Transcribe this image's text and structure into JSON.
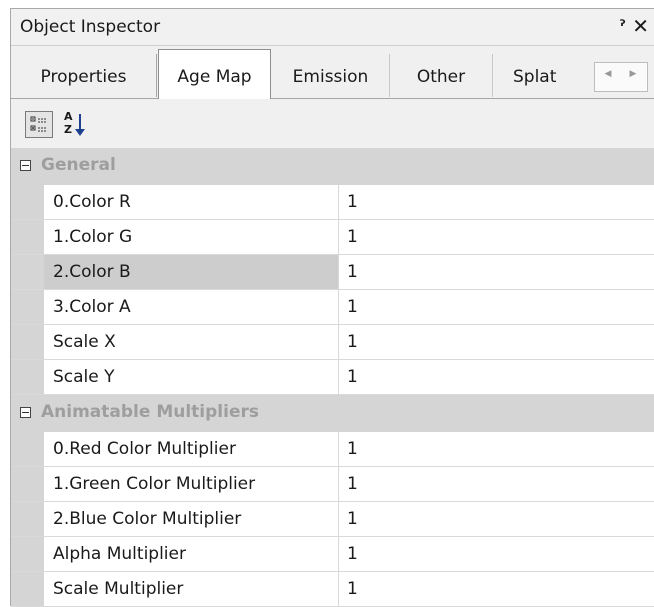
{
  "window": {
    "title": "Object Inspector",
    "pin_icon": "pin-icon",
    "close_icon": "close-icon"
  },
  "tabs": [
    {
      "label": "Properties",
      "active": false
    },
    {
      "label": "Age Map",
      "active": true
    },
    {
      "label": "Emission",
      "active": false
    },
    {
      "label": "Other",
      "active": false
    },
    {
      "label": "Splat",
      "active": false
    }
  ],
  "tab_scroll": {
    "left_icon": "chevron-left-icon",
    "right_icon": "chevron-right-icon"
  },
  "toolbar": {
    "categorized_icon": "categorized-view-icon",
    "sort_icon": "sort-alphabetical-icon",
    "sort_glyph_top": "A",
    "sort_glyph_bottom": "Z"
  },
  "categories": [
    {
      "label": "General",
      "properties": [
        {
          "name": "0.Color R",
          "value": "1",
          "selected": false
        },
        {
          "name": "1.Color G",
          "value": "1",
          "selected": false
        },
        {
          "name": "2.Color B",
          "value": "1",
          "selected": true
        },
        {
          "name": "3.Color A",
          "value": "1",
          "selected": false
        },
        {
          "name": "Scale X",
          "value": "1",
          "selected": false
        },
        {
          "name": "Scale Y",
          "value": "1",
          "selected": false
        }
      ]
    },
    {
      "label": "Animatable Multipliers",
      "properties": [
        {
          "name": "0.Red Color Multiplier",
          "value": "1",
          "selected": false
        },
        {
          "name": "1.Green Color Multiplier",
          "value": "1",
          "selected": false
        },
        {
          "name": "2.Blue Color Multiplier",
          "value": "1",
          "selected": false
        },
        {
          "name": "Alpha Multiplier",
          "value": "1",
          "selected": false
        },
        {
          "name": "Scale Multiplier",
          "value": "1",
          "selected": false
        }
      ]
    }
  ],
  "colors": {
    "category_band": "#d5d5d5",
    "category_text": "#9e9e9e",
    "selected_row": "#cdcdcd"
  }
}
